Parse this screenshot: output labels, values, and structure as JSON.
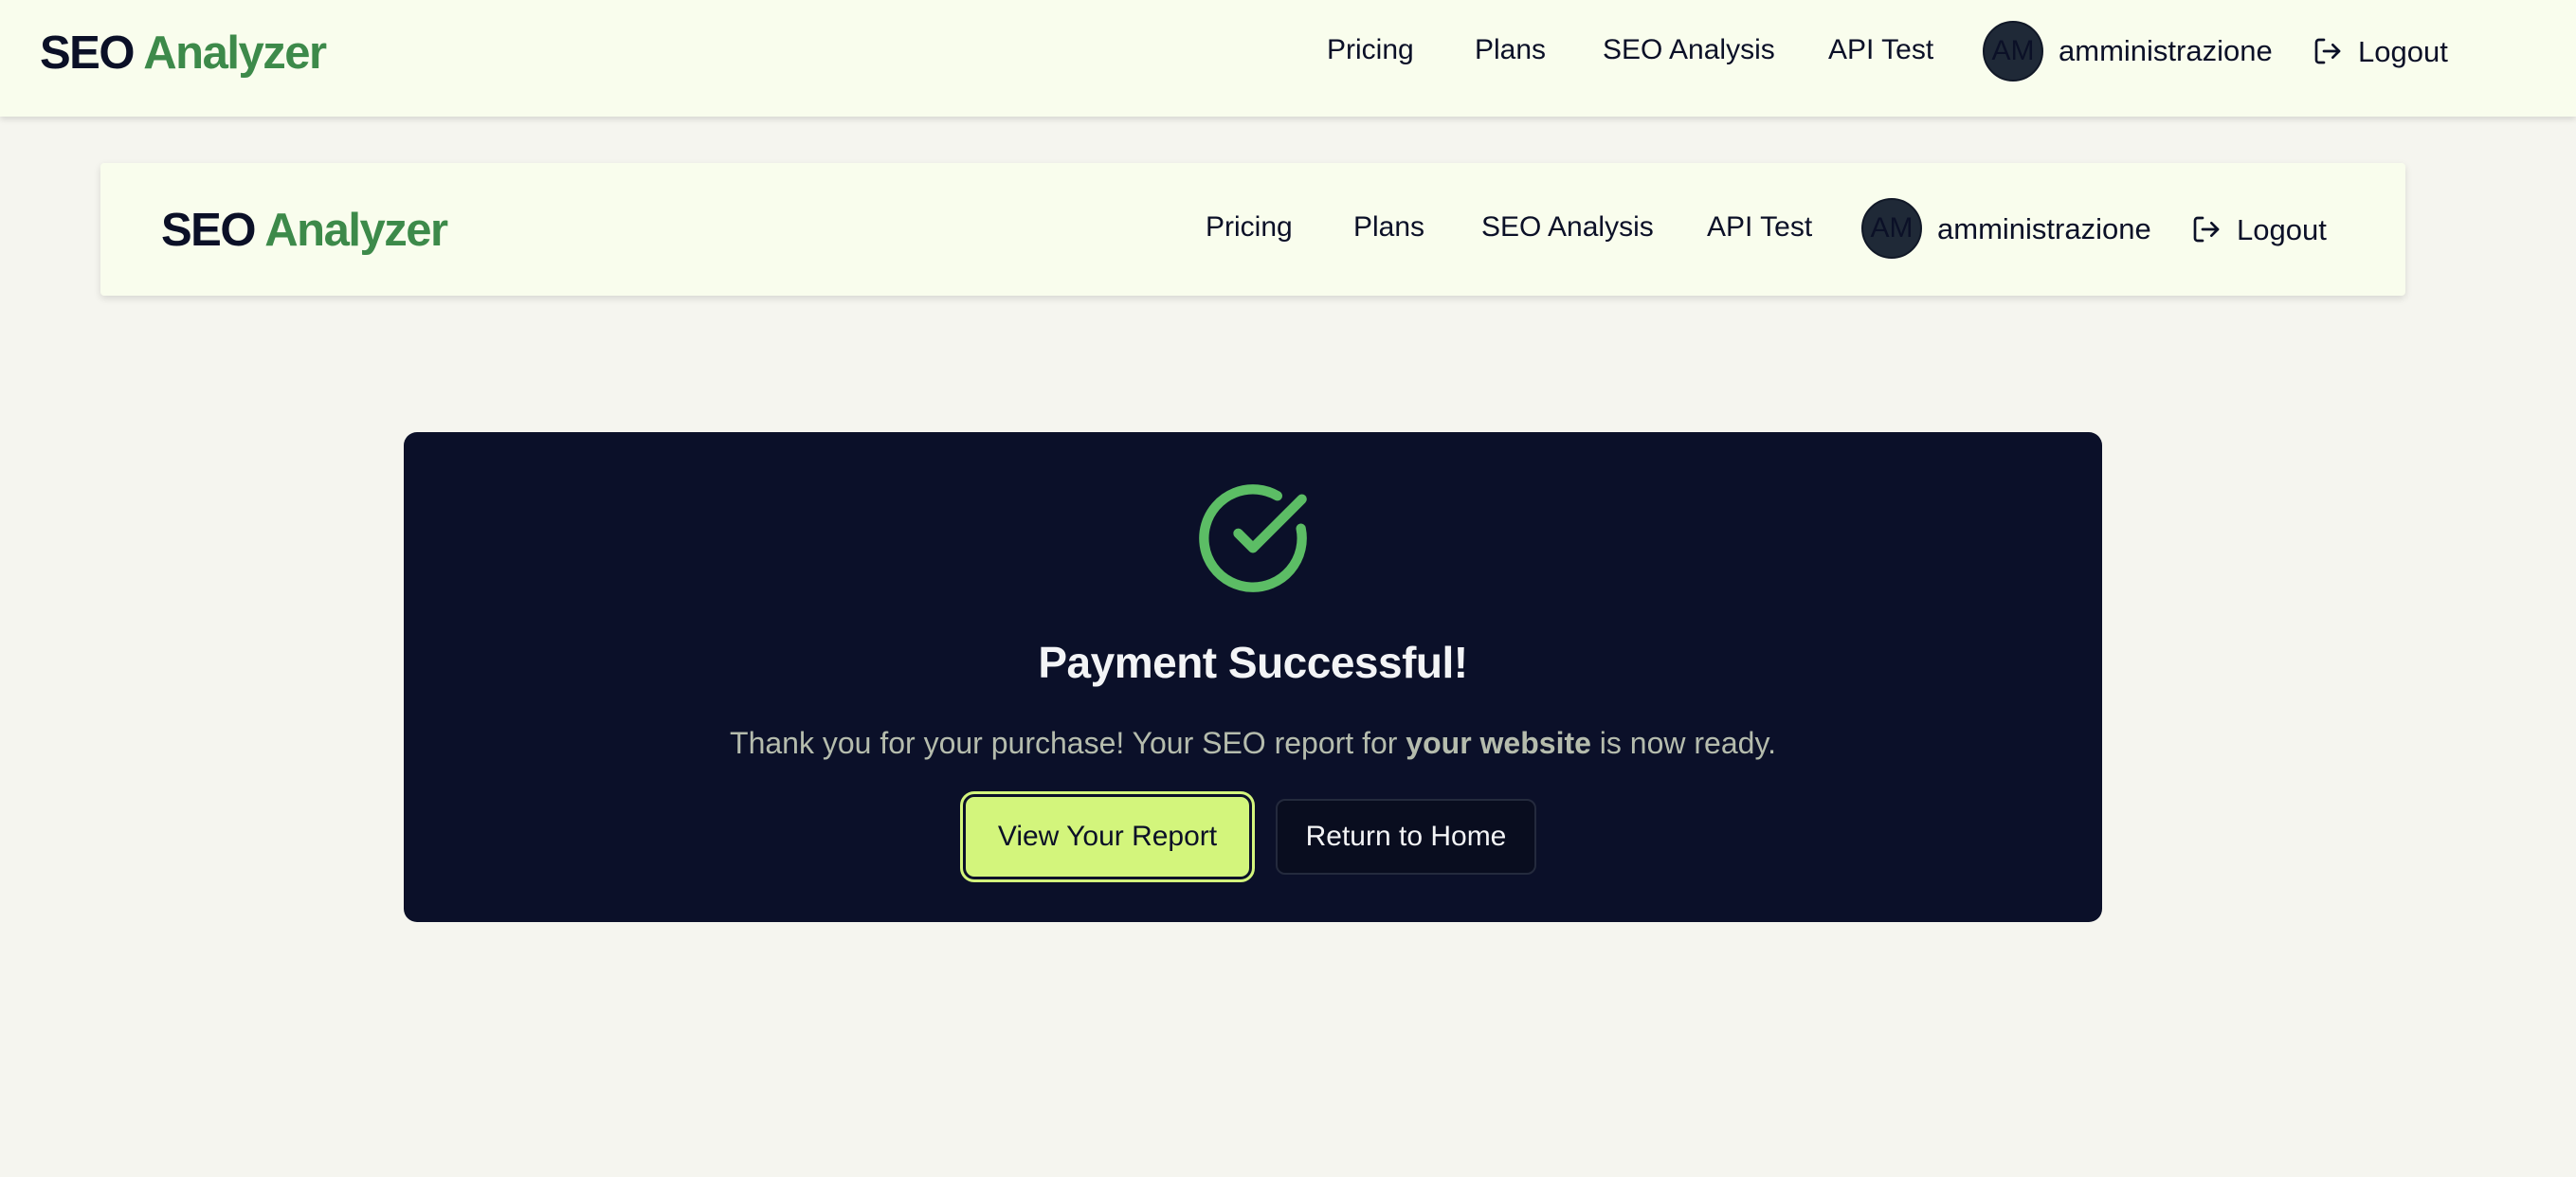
{
  "header": {
    "logo_part1": "SEO",
    "logo_part2": "Analyzer",
    "nav": [
      "Pricing",
      "Plans",
      "SEO Analysis",
      "API Test"
    ],
    "avatar_initials": "AM",
    "username": "amministrazione",
    "logout_label": "Logout"
  },
  "inner_header": {
    "logo_part1": "SEO",
    "logo_part2": "Analyzer",
    "nav": [
      "Pricing",
      "Plans",
      "SEO Analysis",
      "API Test"
    ],
    "avatar_initials": "AM",
    "username": "amministrazione",
    "logout_label": "Logout"
  },
  "card": {
    "icon": "check-circle-icon",
    "title": "Payment Successful!",
    "message_before": "Thank you for your purchase! Your SEO report for ",
    "message_bold": "your website",
    "message_after": " is now ready.",
    "primary_button": "View Your Report",
    "secondary_button": "Return to Home"
  },
  "colors": {
    "background": "#f5f5ef",
    "header_bg": "#f9fded",
    "brand_green": "#3d8a4a",
    "card_bg": "#0b1029",
    "accent": "#d3f57c",
    "success": "#5cbd65"
  }
}
